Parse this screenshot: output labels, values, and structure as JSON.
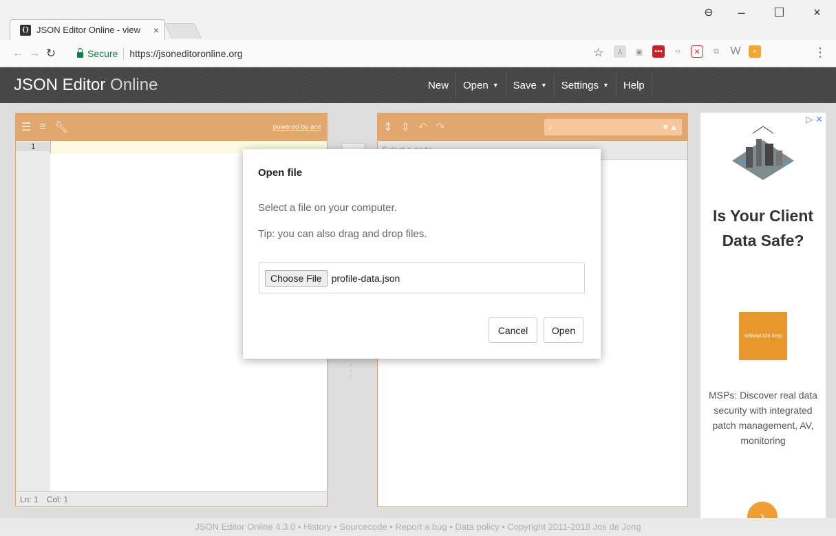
{
  "browser": {
    "tab_title": "JSON Editor Online - view",
    "tab_favicon": "{}",
    "tab_close": "×",
    "secure_label": "Secure",
    "url": "https://jsoneditoronline.org",
    "window_controls": {
      "profile": "⊖",
      "minimize": "–",
      "maximize": "☐",
      "close": "×"
    }
  },
  "app": {
    "logo_main": "JSON Editor",
    "logo_light": "Online",
    "menu": [
      {
        "label": "New"
      },
      {
        "label": "Open"
      },
      {
        "label": "Save"
      },
      {
        "label": "Settings"
      },
      {
        "label": "Help"
      }
    ]
  },
  "left_panel": {
    "powered_by": "powered by ace",
    "line_number": "1",
    "status_ln": "Ln: 1",
    "status_col": "Col: 1"
  },
  "right_panel": {
    "path_placeholder": "Select a node..."
  },
  "dialog": {
    "title": "Open file",
    "line1": "Select a file on your computer.",
    "line2": "Tip: you can also drag and drop files.",
    "choose_file_label": "Choose File",
    "file_name": "profile-data.json",
    "cancel_label": "Cancel",
    "open_label": "Open"
  },
  "ad": {
    "headline": "Is Your Client Data Safe?",
    "logo_text": "solarwinds msp",
    "body": "MSPs: Discover real data security with integrated patch management, AV, monitoring"
  },
  "footer": {
    "text": "JSON Editor Online 4.3.0 • History • Sourcecode • Report a bug • Data policy • Copyright 2011-2018 Jos de Jong"
  },
  "colors": {
    "accent": "#e2a76d",
    "header_bg": "#4a4a4a",
    "secure_green": "#0b8043"
  }
}
